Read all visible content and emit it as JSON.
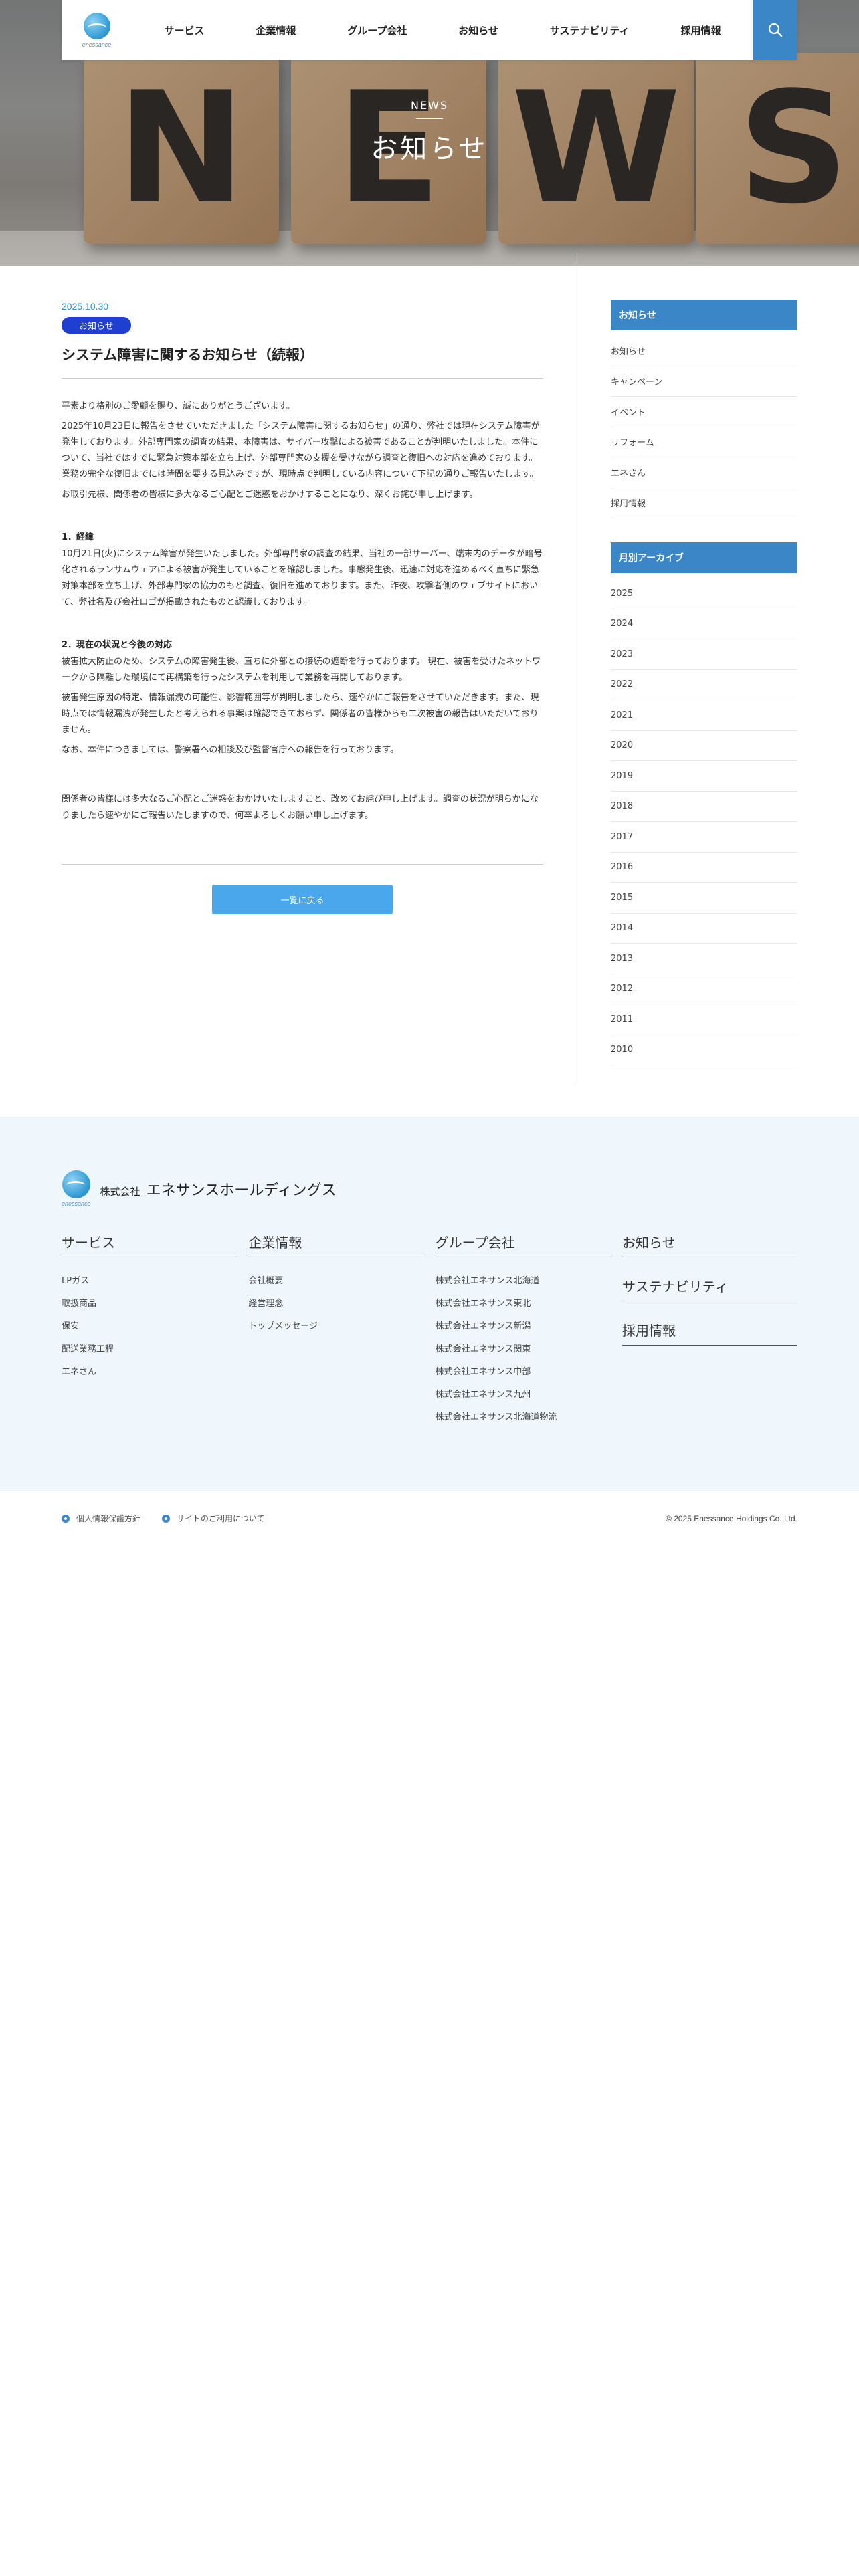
{
  "nav": {
    "logo_text": "enessance",
    "items": [
      "サービス",
      "企業情報",
      "グループ会社",
      "お知らせ",
      "サステナビリティ",
      "採用情報"
    ],
    "search_icon": "search-icon"
  },
  "hero": {
    "letters": [
      "N",
      "E",
      "W",
      "S"
    ],
    "sub": "NEWS",
    "title": "お知らせ"
  },
  "article": {
    "date": "2025.10.30",
    "category": "お知らせ",
    "title": "システム障害に関するお知らせ（続報）",
    "intro": [
      "平素より格別のご愛顧を賜り、誠にありがとうございます。",
      "2025年10月23日に報告をさせていただきました「システム障害に関するお知らせ」の通り、弊社では現在システム障害が発生しております。外部専門家の調査の結果、本障害は、サイバー攻撃による被害であることが判明いたしました。本件について、当社ではすでに緊急対策本部を立ち上げ、外部専門家の支援を受けながら調査と復旧への対応を進めております。業務の完全な復旧までには時間を要する見込みですが、現時点で判明している内容について下記の通りご報告いたします。",
      "お取引先様、関係者の皆様に多大なるご心配とご迷惑をおかけすることになり、深くお詫び申し上げます。"
    ],
    "section1_head": "1．経緯",
    "section1": [
      "10月21日(火)にシステム障害が発生いたしました。外部専門家の調査の結果、当社の一部サーバー、端末内のデータが暗号化されるランサムウェアによる被害が発生していることを確認しました。事態発生後、迅速に対応を進めるべく直ちに緊急対策本部を立ち上げ、外部専門家の協力のもと調査、復旧を進めております。また、昨夜、攻撃者側のウェブサイトにおいて、弊社名及び会社ロゴが掲載されたものと認識しております。"
    ],
    "section2_head": "2．現在の状況と今後の対応",
    "section2": [
      "被害拡大防止のため、システムの障害発生後、直ちに外部との接続の遮断を行っております。 現在、被害を受けたネットワークから隔離した環境にて再構築を行ったシステムを利用して業務を再開しております。",
      "被害発生原因の特定、情報漏洩の可能性、影響範囲等が判明しましたら、速やかにご報告をさせていただきます。また、現時点では情報漏洩が発生したと考えられる事案は確認できておらず、関係者の皆様からも二次被害の報告はいただいておりません。",
      "なお、本件につきましては、警察署への相談及び監督官庁への報告を行っております。"
    ],
    "closing": "関係者の皆様には多大なるご心配とご迷惑をおかけいたしますこと、改めてお詫び申し上げます。調査の状況が明らかになりましたら速やかにご報告いたしますので、何卒よろしくお願い申し上げます。",
    "back_label": "一覧に戻る"
  },
  "sidebar": {
    "category_head": "お知らせ",
    "categories": [
      "お知らせ",
      "キャンペーン",
      "イベント",
      "リフォーム",
      "エネさん",
      "採用情報"
    ],
    "archive_head": "月別アーカイブ",
    "years": [
      "2025",
      "2024",
      "2023",
      "2022",
      "2021",
      "2020",
      "2019",
      "2018",
      "2017",
      "2016",
      "2015",
      "2014",
      "2013",
      "2012",
      "2011",
      "2010"
    ]
  },
  "footer": {
    "logo_text": "enessance",
    "company_prefix": "株式会社",
    "company_name": "エネサンスホールディングス",
    "service": {
      "head": "サービス",
      "links": [
        "LPガス",
        "取扱商品",
        "保安",
        "配送業務工程",
        "エネさん"
      ]
    },
    "corporate": {
      "head": "企業情報",
      "links": [
        "会社概要",
        "経営理念",
        "トップメッセージ"
      ]
    },
    "group": {
      "head": "グループ会社",
      "links": [
        "株式会社エネサンス北海道",
        "株式会社エネサンス東北",
        "株式会社エネサンス新潟",
        "株式会社エネサンス関東",
        "株式会社エネサンス中部",
        "株式会社エネサンス九州",
        "株式会社エネサンス北海道物流"
      ]
    },
    "misc": [
      "お知らせ",
      "サステナビリティ",
      "採用情報"
    ],
    "legal": [
      "個人情報保護方針",
      "サイトのご利用について"
    ],
    "copyright": "© 2025 Enessance Holdings Co.,Ltd."
  }
}
